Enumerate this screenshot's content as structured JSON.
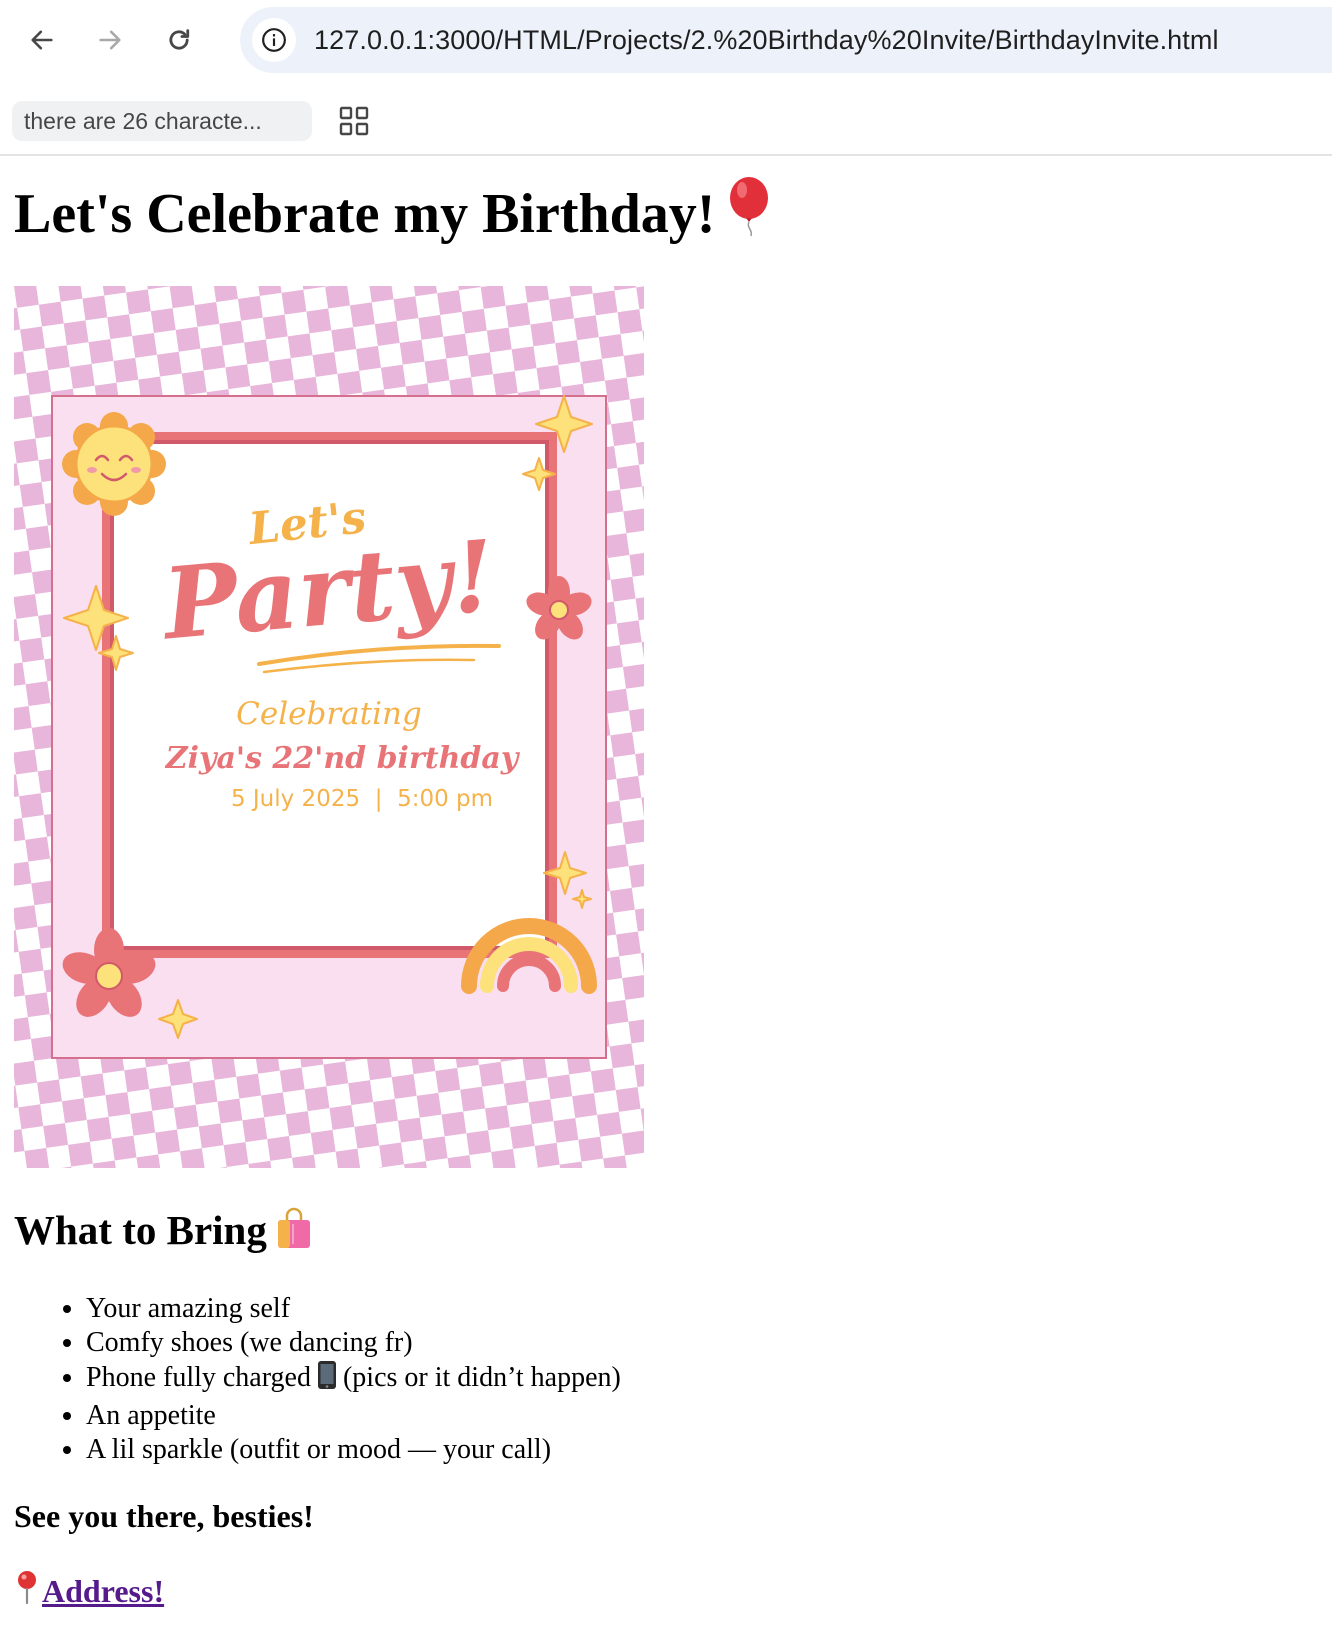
{
  "browser": {
    "url": "127.0.0.1:3000/HTML/Projects/2.%20Birthday%20Invite/BirthdayInvite.html",
    "bookmark_label": "there are 26 characte..."
  },
  "page": {
    "title": "Let's Celebrate my Birthday!",
    "title_emoji": "balloon-icon",
    "invite_image": {
      "heading_small": "Let's",
      "heading_large": "Party!",
      "line1": "Celebrating",
      "line2": "Ziya's 22'nd birthday",
      "line3": "5 July 2025  |  5:00 pm",
      "colors": {
        "checker": "#e8b6db",
        "frame": "#e87478",
        "panel": "#f9dff0",
        "gold": "#f5b24a",
        "yellow": "#fde17a"
      }
    },
    "bring_heading": "What to Bring",
    "bring_emoji": "shopping-bag-icon",
    "bring_items": [
      {
        "text": "Your amazing self"
      },
      {
        "text": "Comfy shoes (we dancing fr)"
      },
      {
        "before": "Phone fully charged",
        "after": "(pics or it didn’t happen)"
      },
      {
        "text": "An appetite"
      },
      {
        "text": "A lil sparkle (outfit or mood — your call)"
      }
    ],
    "closing": "See you there, besties!",
    "address_link": "Address!",
    "link_color": "#551a8b"
  }
}
